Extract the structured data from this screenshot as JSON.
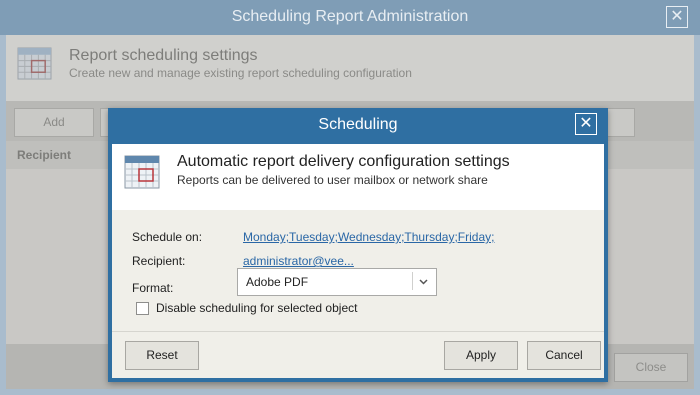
{
  "background_window": {
    "title": "Scheduling Report Administration",
    "close_glyph": "✕",
    "heading": "Report scheduling settings",
    "subheading": "Create new and manage existing report scheduling configuration",
    "add_label": "Add",
    "column_recipient": "Recipient",
    "close_label": "Close",
    "icon": "calendar-icon"
  },
  "dialog": {
    "title": "Scheduling",
    "close_glyph": "✕",
    "heading": "Automatic report delivery configuration settings",
    "subheading": "Reports can be delivered to user mailbox or network share",
    "icon": "calendar-icon",
    "schedule_label": "Schedule on:",
    "schedule_value": "Monday;Tuesday;Wednesday;Thursday;Friday;",
    "recipient_label": "Recipient:",
    "recipient_value": "administrator@vee...",
    "format_label": "Format:",
    "format_value": "Adobe PDF",
    "disable_label": "Disable scheduling for selected object",
    "disable_checked": false,
    "reset_label": "Reset",
    "apply_label": "Apply",
    "cancel_label": "Cancel"
  },
  "colors": {
    "dialog_title_bar": "#2f6fa2",
    "link": "#2a67a6",
    "dim_title_bar": "#7f9db6"
  }
}
